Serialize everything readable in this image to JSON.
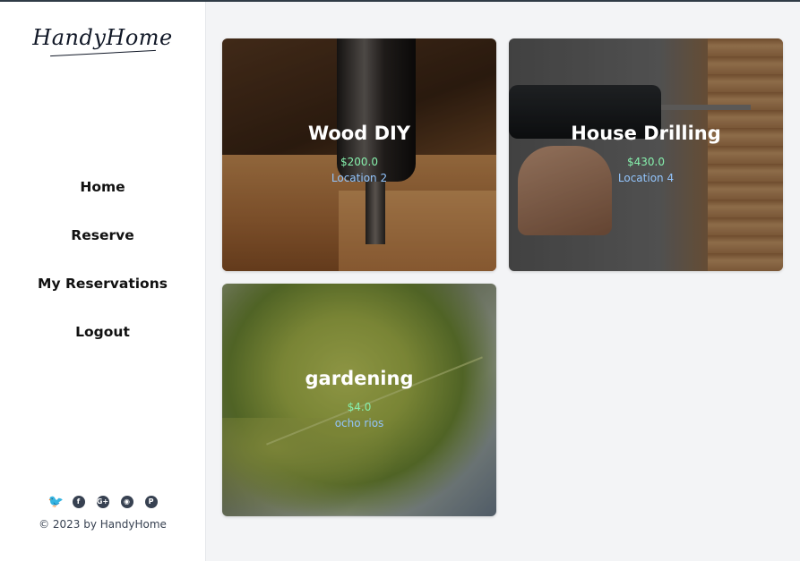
{
  "app": {
    "logo": "HandyHome"
  },
  "sidebar": {
    "nav": [
      {
        "label": "Home"
      },
      {
        "label": "Reserve"
      },
      {
        "label": "My Reservations"
      },
      {
        "label": "Logout"
      }
    ],
    "social_icons": [
      "twitter-icon",
      "facebook-icon",
      "google-plus-icon",
      "github-icon",
      "pinterest-icon"
    ],
    "copyright": "© 2023 by HandyHome"
  },
  "cards": [
    {
      "title": "Wood DIY",
      "price": "$200.0",
      "location": "Location 2",
      "image": "wood-drill-photo"
    },
    {
      "title": "House Drilling",
      "price": "$430.0",
      "location": "Location 4",
      "image": "power-drill-photo"
    },
    {
      "title": "gardening",
      "price": "$4.0",
      "location": "ocho rios",
      "image": "green-leaf-photo"
    }
  ],
  "colors": {
    "price": "#86efac",
    "location": "#93c5fd",
    "background": "#f3f4f6"
  }
}
